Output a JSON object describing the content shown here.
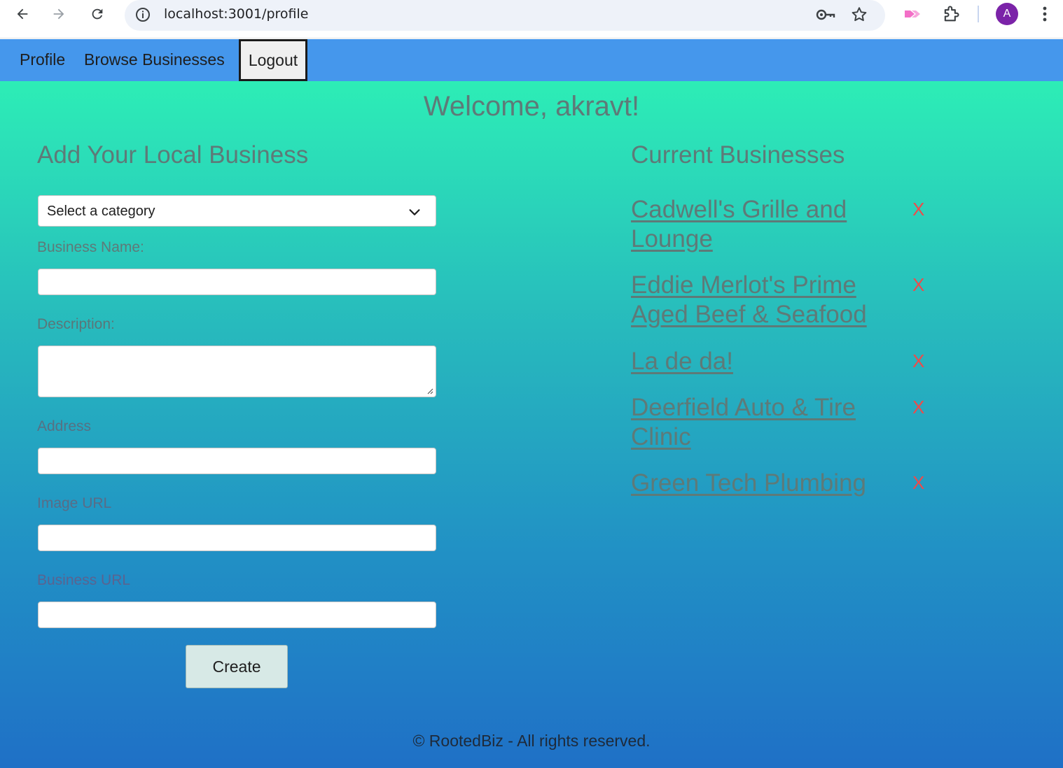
{
  "browser": {
    "url": "localhost:3001/profile",
    "profile_initial": "A",
    "icons": [
      "back-arrow-icon",
      "forward-arrow-icon",
      "reload-icon",
      "site-info-icon",
      "password-key-icon",
      "bookmark-star-icon",
      "extension-icon",
      "puzzle-icon",
      "menu-icon"
    ]
  },
  "nav": {
    "profile": "Profile",
    "browse": "Browse Businesses",
    "logout": "Logout"
  },
  "welcome": "Welcome, akravt!",
  "form": {
    "title": "Add Your Local Business",
    "category_selected": "Select a category",
    "labels": {
      "name": "Business Name:",
      "description": "Description:",
      "address": "Address",
      "image_url": "Image URL",
      "business_url": "Business URL"
    },
    "values": {
      "name": "",
      "description": "",
      "address": "",
      "image_url": "",
      "business_url": ""
    },
    "create_label": "Create"
  },
  "businesses": {
    "title": "Current Businesses",
    "items": [
      {
        "name": "Cadwell's Grille and Lounge",
        "delete_label": "X"
      },
      {
        "name": "Eddie Merlot's Prime Aged Beef & Seafood",
        "delete_label": "X"
      },
      {
        "name": "La de da!",
        "delete_label": "X"
      },
      {
        "name": "Deerfield Auto & Tire Clinic",
        "delete_label": "X"
      },
      {
        "name": "Green Tech Plumbing",
        "delete_label": "X"
      }
    ]
  },
  "footer": "© RootedBiz - All rights reserved.",
  "colors": {
    "navbar": "#4597ec",
    "gradient_top": "#2ef6b5",
    "gradient_bottom": "#1f70c6",
    "heading_text": "#5e7a78",
    "delete_red": "#ef4a4a"
  }
}
